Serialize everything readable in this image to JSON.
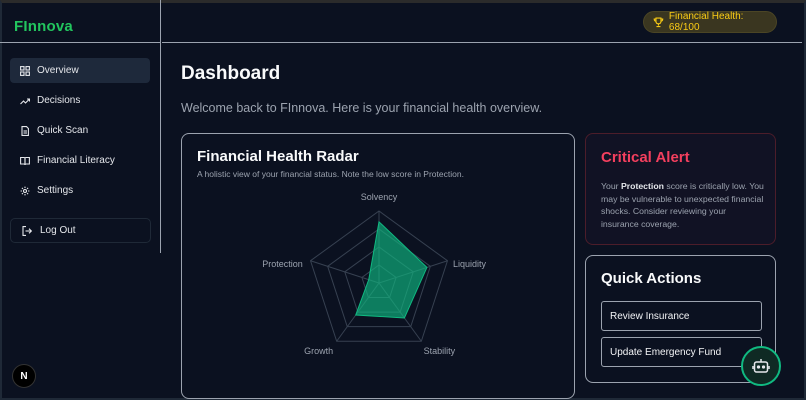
{
  "app": {
    "logo": "FInnova"
  },
  "sidebar": {
    "items": [
      {
        "label": "Overview",
        "icon": "grid-icon",
        "active": true
      },
      {
        "label": "Decisions",
        "icon": "trending-up-icon",
        "active": false
      },
      {
        "label": "Quick Scan",
        "icon": "file-icon",
        "active": false
      },
      {
        "label": "Financial Literacy",
        "icon": "book-icon",
        "active": false
      },
      {
        "label": "Settings",
        "icon": "gear-icon",
        "active": false
      }
    ],
    "logout_label": "Log Out"
  },
  "header": {
    "health_label": "Financial Health: 68/100"
  },
  "main": {
    "title": "Dashboard",
    "welcome": "Welcome back to FInnova. Here is your financial health overview."
  },
  "radar": {
    "title": "Financial Health Radar",
    "subtitle": "A holistic view of your financial status. Note the low score in Protection.",
    "axes": [
      "Solvency",
      "Liquidity",
      "Stability",
      "Growth",
      "Protection"
    ],
    "values": [
      85,
      70,
      60,
      55,
      15
    ],
    "max": 100,
    "levels": 4,
    "fill_color": "#10b981"
  },
  "alert": {
    "title": "Critical Alert",
    "text_prefix": "Your ",
    "text_bold": "Protection",
    "text_suffix": " score is critically low. You may be vulnerable to unexpected financial shocks. Consider reviewing your insurance coverage."
  },
  "quick_actions": {
    "title": "Quick Actions",
    "buttons": [
      "Review Insurance",
      "Update Emergency Fund"
    ]
  },
  "colors": {
    "accent": "#22c55e",
    "warning": "#facc15",
    "danger": "#f43f5e",
    "bg": "#0b1120"
  },
  "badge": {
    "letter": "N"
  }
}
